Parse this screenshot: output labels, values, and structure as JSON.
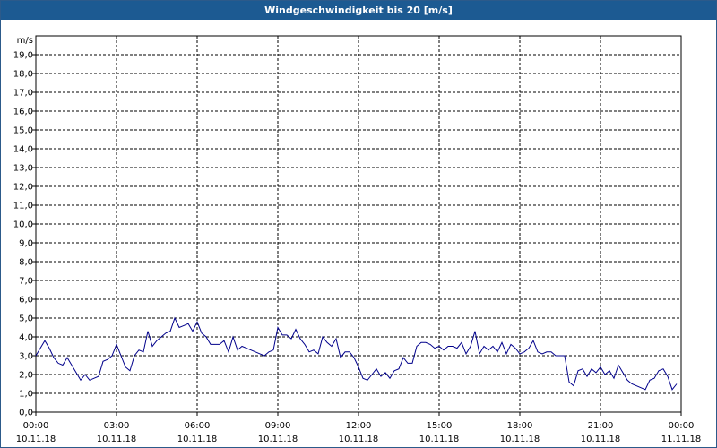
{
  "window": {
    "title": "Windgeschwindigkeit bis 20 [m/s]"
  },
  "colors": {
    "titlebar": "#1c5a92",
    "series": "#00008b",
    "grid": "#000000",
    "background": "#ffffff"
  },
  "chart_data": {
    "type": "line",
    "title": "Windgeschwindigkeit bis 20 [m/s]",
    "ylabel": "m/s",
    "xlabel": "",
    "ylim": [
      0,
      20
    ],
    "y_ticks": [
      "0,0",
      "1,0",
      "2,0",
      "3,0",
      "4,0",
      "5,0",
      "6,0",
      "7,0",
      "8,0",
      "9,0",
      "10,0",
      "11,0",
      "12,0",
      "13,0",
      "14,0",
      "15,0",
      "16,0",
      "17,0",
      "18,0",
      "19,0"
    ],
    "x_range_hours": [
      0,
      24
    ],
    "x_ticks": [
      {
        "time": "00:00",
        "date": "10.11.18"
      },
      {
        "time": "03:00",
        "date": "10.11.18"
      },
      {
        "time": "06:00",
        "date": "10.11.18"
      },
      {
        "time": "09:00",
        "date": "10.11.18"
      },
      {
        "time": "12:00",
        "date": "10.11.18"
      },
      {
        "time": "15:00",
        "date": "10.11.18"
      },
      {
        "time": "18:00",
        "date": "10.11.18"
      },
      {
        "time": "21:00",
        "date": "10.11.18"
      },
      {
        "time": "00:00",
        "date": "11.11.18"
      }
    ],
    "grid": true,
    "series": [
      {
        "x": [
          "10.11.18 00:00",
          "10.11.18 00:10",
          "10.11.18 00:20",
          "10.11.18 00:30",
          "10.11.18 00:40",
          "10.11.18 00:50",
          "10.11.18 01:00",
          "10.11.18 01:10",
          "10.11.18 01:20",
          "10.11.18 01:30",
          "10.11.18 01:40",
          "10.11.18 01:50",
          "10.11.18 02:00",
          "10.11.18 02:10",
          "10.11.18 02:20",
          "10.11.18 02:30",
          "10.11.18 02:40",
          "10.11.18 02:50",
          "10.11.18 03:00",
          "10.11.18 03:10",
          "10.11.18 03:20",
          "10.11.18 03:30",
          "10.11.18 03:40",
          "10.11.18 03:50",
          "10.11.18 04:00",
          "10.11.18 04:10",
          "10.11.18 04:20",
          "10.11.18 04:30",
          "10.11.18 04:40",
          "10.11.18 04:50",
          "10.11.18 05:00",
          "10.11.18 05:10",
          "10.11.18 05:20",
          "10.11.18 05:30",
          "10.11.18 05:40",
          "10.11.18 05:50",
          "10.11.18 06:00",
          "10.11.18 06:10",
          "10.11.18 06:20",
          "10.11.18 06:30",
          "10.11.18 06:40",
          "10.11.18 06:50",
          "10.11.18 07:00",
          "10.11.18 07:10",
          "10.11.18 07:20",
          "10.11.18 07:30",
          "10.11.18 07:40",
          "10.11.18 07:50",
          "10.11.18 08:00",
          "10.11.18 08:10",
          "10.11.18 08:20",
          "10.11.18 08:30",
          "10.11.18 08:40",
          "10.11.18 08:50",
          "10.11.18 09:00",
          "10.11.18 09:10",
          "10.11.18 09:20",
          "10.11.18 09:30",
          "10.11.18 09:40",
          "10.11.18 09:50",
          "10.11.18 10:00",
          "10.11.18 10:10",
          "10.11.18 10:20",
          "10.11.18 10:30",
          "10.11.18 10:40",
          "10.11.18 10:50",
          "10.11.18 11:00",
          "10.11.18 11:10",
          "10.11.18 11:20",
          "10.11.18 11:30",
          "10.11.18 11:40",
          "10.11.18 11:50",
          "10.11.18 12:00",
          "10.11.18 12:10",
          "10.11.18 12:20",
          "10.11.18 12:30",
          "10.11.18 12:40",
          "10.11.18 12:50",
          "10.11.18 13:00",
          "10.11.18 13:10",
          "10.11.18 13:20",
          "10.11.18 13:30",
          "10.11.18 13:40",
          "10.11.18 13:50",
          "10.11.18 14:00",
          "10.11.18 14:10",
          "10.11.18 14:20",
          "10.11.18 14:30",
          "10.11.18 14:40",
          "10.11.18 14:50",
          "10.11.18 15:00",
          "10.11.18 15:10",
          "10.11.18 15:20",
          "10.11.18 15:30",
          "10.11.18 15:40",
          "10.11.18 15:50",
          "10.11.18 16:00",
          "10.11.18 16:10",
          "10.11.18 16:20",
          "10.11.18 16:30",
          "10.11.18 16:40",
          "10.11.18 16:50",
          "10.11.18 17:00",
          "10.11.18 17:10",
          "10.11.18 17:20",
          "10.11.18 17:30",
          "10.11.18 17:40",
          "10.11.18 17:50",
          "10.11.18 18:00",
          "10.11.18 18:10",
          "10.11.18 18:20",
          "10.11.18 18:30",
          "10.11.18 18:40",
          "10.11.18 18:50",
          "10.11.18 19:00",
          "10.11.18 19:10",
          "10.11.18 19:20",
          "10.11.18 19:30",
          "10.11.18 19:40",
          "10.11.18 19:50",
          "10.11.18 20:00",
          "10.11.18 20:10",
          "10.11.18 20:20",
          "10.11.18 20:30",
          "10.11.18 20:40",
          "10.11.18 20:50",
          "10.11.18 21:00",
          "10.11.18 21:10",
          "10.11.18 21:20",
          "10.11.18 21:30",
          "10.11.18 21:40",
          "10.11.18 21:50",
          "10.11.18 22:00",
          "10.11.18 22:10",
          "10.11.18 22:20",
          "10.11.18 22:30",
          "10.11.18 22:40",
          "10.11.18 22:50",
          "10.11.18 23:00",
          "10.11.18 23:10",
          "10.11.18 23:20",
          "10.11.18 23:30",
          "10.11.18 23:40",
          "10.11.18 23:50"
        ],
        "values": [
          3.0,
          3.4,
          3.8,
          3.4,
          2.9,
          2.6,
          2.5,
          2.9,
          2.5,
          2.1,
          1.7,
          2.0,
          1.7,
          1.8,
          1.9,
          2.7,
          2.8,
          3.0,
          3.6,
          3.0,
          2.4,
          2.2,
          3.0,
          3.3,
          3.2,
          4.3,
          3.5,
          3.8,
          4.0,
          4.2,
          4.3,
          5.0,
          4.5,
          4.6,
          4.7,
          4.3,
          4.8,
          4.2,
          4.0,
          3.6,
          3.6,
          3.6,
          3.8,
          3.2,
          4.0,
          3.3,
          3.5,
          3.4,
          3.3,
          3.2,
          3.1,
          3.0,
          3.2,
          3.3,
          4.5,
          4.1,
          4.1,
          3.9,
          4.4,
          3.9,
          3.6,
          3.2,
          3.3,
          3.1,
          4.0,
          3.7,
          3.5,
          3.9,
          2.9,
          3.2,
          3.2,
          2.9,
          2.4,
          1.8,
          1.7,
          2.0,
          2.3,
          1.9,
          2.1,
          1.8,
          2.2,
          2.3,
          2.9,
          2.6,
          2.6,
          3.5,
          3.7,
          3.7,
          3.6,
          3.4,
          3.5,
          3.3,
          3.5,
          3.5,
          3.4,
          3.7,
          3.1,
          3.5,
          4.3,
          3.1,
          3.5,
          3.3,
          3.5,
          3.2,
          3.7,
          3.1,
          3.6,
          3.4,
          3.1,
          3.2,
          3.4,
          3.8,
          3.2,
          3.1,
          3.2,
          3.2,
          3.0,
          3.0,
          3.0,
          1.6,
          1.4,
          2.2,
          2.3,
          1.9,
          2.3,
          2.1,
          2.4,
          2.0,
          2.2,
          1.8,
          2.5,
          2.1,
          1.7,
          1.5,
          1.4,
          1.3,
          1.2,
          1.7,
          1.8,
          2.2,
          2.3,
          1.9,
          1.2,
          1.5
        ]
      }
    ]
  }
}
